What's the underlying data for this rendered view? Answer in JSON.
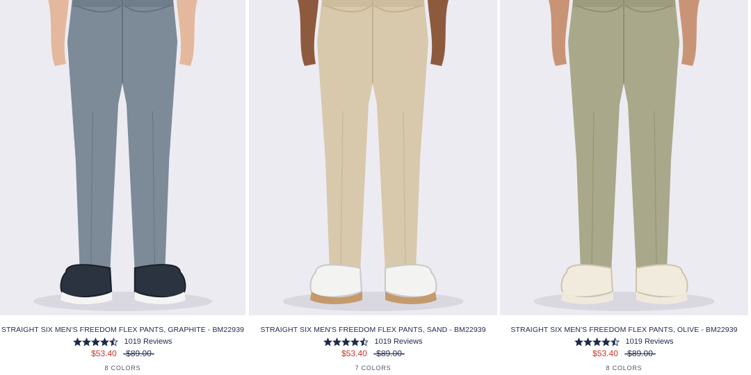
{
  "products": [
    {
      "title": "STRAIGHT SIX MEN'S FREEDOM FLEX PANTS, GRAPHITE - BM22939",
      "rating": 4.5,
      "reviews": "1019 Reviews",
      "sale_price": "$53.40",
      "original_price": "-$89.00-",
      "colors": "8 COLORS",
      "pant_color": "#7d8b99",
      "pant_shade": "#64727f",
      "shoe": "dark-sneakers"
    },
    {
      "title": "STRAIGHT SIX MEN'S FREEDOM FLEX PANTS, SAND - BM22939",
      "rating": 4.5,
      "reviews": "1019 Reviews",
      "sale_price": "$53.40",
      "original_price": "-$89.00-",
      "colors": "7 COLORS",
      "pant_color": "#d8c9ac",
      "pant_shade": "#c2b190",
      "shoe": "white-gum-sneakers"
    },
    {
      "title": "STRAIGHT SIX MEN'S FREEDOM FLEX PANTS, OLIVE - BM22939",
      "rating": 4.5,
      "reviews": "1019 Reviews",
      "sale_price": "$53.40",
      "original_price": "-$89.00-",
      "colors": "8 COLORS",
      "pant_color": "#a9a88a",
      "pant_shade": "#918f72",
      "shoe": "cream-canvas-sneakers"
    }
  ],
  "colors": {
    "text": "#1d2a4d",
    "sale": "#d0312d",
    "star": "#1d2a4d",
    "photo_bg": "#ecebf1"
  }
}
